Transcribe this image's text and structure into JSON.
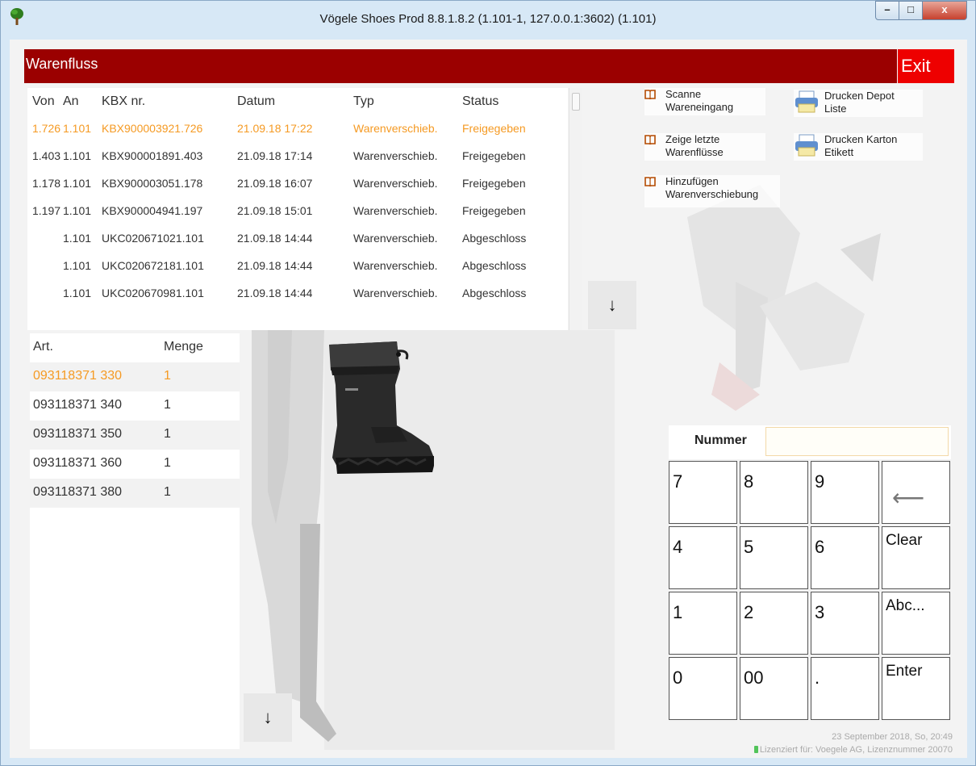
{
  "window": {
    "title": "Vögele Shoes Prod 8.8.1.8.2 (1.101-1, 127.0.0.1:3602) (1.101)",
    "minimize_label": "–",
    "maximize_label": "□",
    "close_label": "x"
  },
  "header": {
    "title": "Warenfluss",
    "exit_label": "Exit",
    "accent_color": "#9b0000",
    "exit_color": "#ee0000"
  },
  "transfers": {
    "columns": [
      "Von",
      "An",
      "KBX nr.",
      "Datum",
      "Typ",
      "Status"
    ],
    "rows": [
      {
        "von": "1.726",
        "an": "1.101",
        "kbx": "KBX900003921.726",
        "datum": "21.09.18 17:22",
        "typ": "Warenverschieb.",
        "status": "Freigegeben",
        "selected": true
      },
      {
        "von": "1.403",
        "an": "1.101",
        "kbx": "KBX900001891.403",
        "datum": "21.09.18 17:14",
        "typ": "Warenverschieb.",
        "status": "Freigegeben"
      },
      {
        "von": "1.178",
        "an": "1.101",
        "kbx": "KBX900003051.178",
        "datum": "21.09.18 16:07",
        "typ": "Warenverschieb.",
        "status": "Freigegeben"
      },
      {
        "von": "1.197",
        "an": "1.101",
        "kbx": "KBX900004941.197",
        "datum": "21.09.18 15:01",
        "typ": "Warenverschieb.",
        "status": "Freigegeben"
      },
      {
        "von": "",
        "an": "1.101",
        "kbx": "UKC020671021.101",
        "datum": "21.09.18 14:44",
        "typ": "Warenverschieb.",
        "status": "Abgeschloss"
      },
      {
        "von": "",
        "an": "1.101",
        "kbx": "UKC020672181.101",
        "datum": "21.09.18 14:44",
        "typ": "Warenverschieb.",
        "status": "Abgeschloss"
      },
      {
        "von": "",
        "an": "1.101",
        "kbx": "UKC020670981.101",
        "datum": "21.09.18 14:44",
        "typ": "Warenverschieb.",
        "status": "Abgeschloss"
      }
    ],
    "selected_color": "#f59a23",
    "scroll_down_label": "↓"
  },
  "actions": {
    "scan": "Scanne\nWareneingang",
    "last_flows": "Zeige letzte\nWarenflüsse",
    "add_transfer": "Hinzufügen\nWarenverschiebung",
    "print_depot": "Drucken Depot\nListe",
    "print_label": "Drucken Karton\nEtikett"
  },
  "articles": {
    "columns": [
      "Art.",
      "Menge"
    ],
    "rows": [
      {
        "art": "093118371 330",
        "menge": "1",
        "selected": true
      },
      {
        "art": "093118371 340",
        "menge": "1"
      },
      {
        "art": "093118371 350",
        "menge": "1"
      },
      {
        "art": "093118371 360",
        "menge": "1"
      },
      {
        "art": "093118371 380",
        "menge": "1"
      }
    ],
    "scroll_down_label": "↓"
  },
  "keypad": {
    "nummer_label": "Nummer",
    "nummer_value": "",
    "keys": [
      "7",
      "8",
      "9",
      "⟵",
      "4",
      "5",
      "6",
      "Clear",
      "1",
      "2",
      "3",
      "Abc...",
      "0",
      "00",
      ".",
      "Enter"
    ]
  },
  "footer": {
    "datetime": "23 September 2018, So, 20:49",
    "license": "Lizenziert für: Voegele AG, Lizenznummer 20070"
  }
}
